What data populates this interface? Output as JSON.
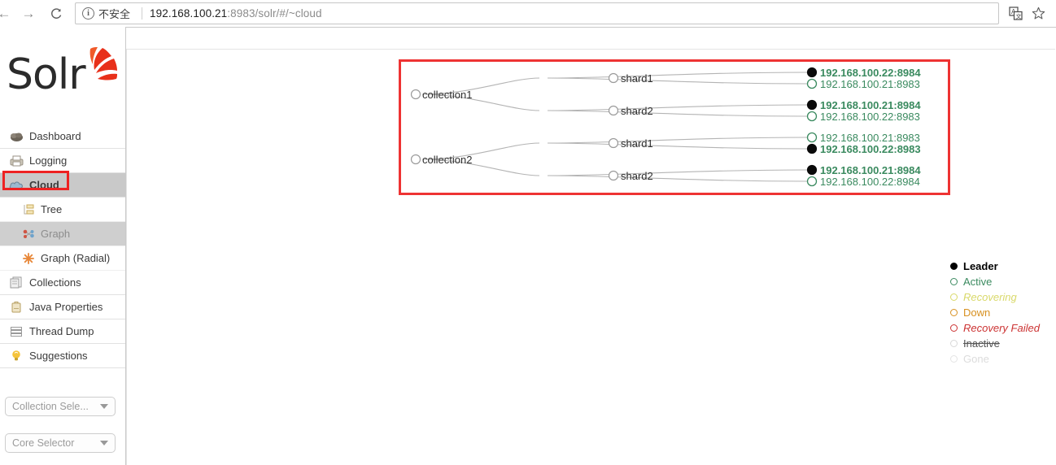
{
  "browser": {
    "back_icon": "arrow-left-icon",
    "forward_icon": "arrow-right-icon",
    "reload_icon": "reload-icon",
    "security_icon": "info-circle-icon",
    "security_label": "不安全",
    "url_host": "192.168.100.21",
    "url_rest": ":8983/solr/#/~cloud",
    "translate_icon": "translate-icon",
    "bookmark_icon": "star-icon"
  },
  "sidebar": {
    "logo_text": "Solr",
    "items": [
      {
        "label": "Dashboard",
        "icon": "dashboard-icon",
        "active": false
      },
      {
        "label": "Logging",
        "icon": "logging-icon",
        "active": false
      },
      {
        "label": "Cloud",
        "icon": "cloud-icon",
        "active": true
      }
    ],
    "sub_items": [
      {
        "label": "Tree",
        "icon": "tree-icon",
        "selected": false
      },
      {
        "label": "Graph",
        "icon": "graph-icon",
        "selected": true
      },
      {
        "label": "Graph (Radial)",
        "icon": "graph-radial-icon",
        "selected": false
      }
    ],
    "items_after": [
      {
        "label": "Collections",
        "icon": "collections-icon",
        "active": false
      },
      {
        "label": "Java Properties",
        "icon": "java-properties-icon",
        "active": false
      },
      {
        "label": "Thread Dump",
        "icon": "thread-dump-icon",
        "active": false
      },
      {
        "label": "Suggestions",
        "icon": "suggestions-icon",
        "active": false
      }
    ],
    "collection_selector": {
      "label": "Collection Sele...",
      "icon": "chevron-down-icon"
    },
    "core_selector": {
      "label": "Core Selector",
      "icon": "chevron-down-icon"
    }
  },
  "graph": {
    "collections": [
      {
        "name": "collection1",
        "shards": [
          {
            "name": "shard1",
            "replicas": [
              {
                "label": "192.168.100.22:8984",
                "leader": true,
                "state": "active"
              },
              {
                "label": "192.168.100.21:8983",
                "leader": false,
                "state": "active"
              }
            ]
          },
          {
            "name": "shard2",
            "replicas": [
              {
                "label": "192.168.100.21:8984",
                "leader": true,
                "state": "active"
              },
              {
                "label": "192.168.100.22:8983",
                "leader": false,
                "state": "active"
              }
            ]
          }
        ]
      },
      {
        "name": "collection2",
        "shards": [
          {
            "name": "shard1",
            "replicas": [
              {
                "label": "192.168.100.21:8983",
                "leader": false,
                "state": "active"
              },
              {
                "label": "192.168.100.22:8983",
                "leader": true,
                "state": "active"
              }
            ]
          },
          {
            "name": "shard2",
            "replicas": [
              {
                "label": "192.168.100.21:8984",
                "leader": true,
                "state": "active"
              },
              {
                "label": "192.168.100.22:8984",
                "leader": false,
                "state": "active"
              }
            ]
          }
        ]
      }
    ]
  },
  "legend": {
    "items": [
      {
        "label": "Leader",
        "color": "#000000",
        "filled": true,
        "bold": true,
        "italic": false,
        "strike": false
      },
      {
        "label": "Active",
        "color": "#3a8a5f",
        "filled": false,
        "bold": false,
        "italic": false,
        "strike": false
      },
      {
        "label": "Recovering",
        "color": "#d9d96a",
        "filled": false,
        "bold": false,
        "italic": true,
        "strike": false
      },
      {
        "label": "Down",
        "color": "#d79020",
        "filled": false,
        "bold": false,
        "italic": false,
        "strike": false
      },
      {
        "label": "Recovery Failed",
        "color": "#cc3333",
        "filled": false,
        "bold": false,
        "italic": true,
        "strike": false
      },
      {
        "label": "Inactive",
        "color": "#bdbdbd",
        "filled": false,
        "bold": false,
        "italic": false,
        "strike": true
      },
      {
        "label": "Gone",
        "color": "#dcdcdc",
        "filled": false,
        "bold": false,
        "italic": false,
        "strike": false
      }
    ]
  },
  "colors": {
    "accent_green": "#3a8a5f",
    "annotation_red": "#ee3333",
    "edge_gray": "#b4b4b4"
  }
}
